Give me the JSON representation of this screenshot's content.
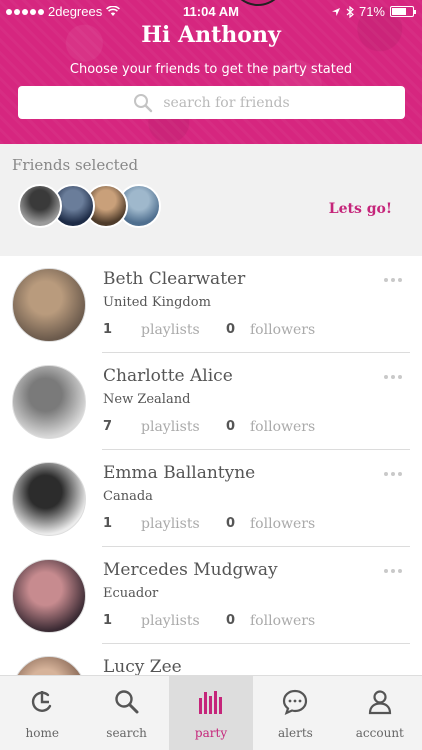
{
  "status_bar": {
    "carrier": "2degrees",
    "time": "11:04 AM",
    "battery": "71%",
    "battery_level": 0.71
  },
  "header": {
    "greeting": "Hi Anthony",
    "subtitle": "Choose your friends to get the party stated",
    "search": {
      "placeholder": "search for friends",
      "icon": "search-icon"
    }
  },
  "selected": {
    "label": "Friends selected",
    "action_label": "Lets go!",
    "avatars": [
      {
        "icon": "avatar-group-photo",
        "colors": [
          "#9a9a9a",
          "#3a3a3a"
        ]
      },
      {
        "icon": "avatar-group-photo",
        "colors": [
          "#1d2b46",
          "#6a7d9a"
        ]
      },
      {
        "icon": "avatar-group-photo",
        "colors": [
          "#4e3b2a",
          "#c9a07a"
        ]
      },
      {
        "icon": "avatar-group-photo",
        "colors": [
          "#4f6f8f",
          "#9fb8cc"
        ]
      }
    ]
  },
  "friends": [
    {
      "name": "Beth Clearwater",
      "country": "United Kingdom",
      "playlists": "1",
      "playlists_label": "playlists",
      "followers": "0",
      "followers_label": "followers",
      "colors": [
        "#6b5a4c",
        "#b99b7d"
      ]
    },
    {
      "name": "Charlotte Alice",
      "country": "New Zealand",
      "playlists": "7",
      "playlists_label": "playlists",
      "followers": "0",
      "followers_label": "followers",
      "colors": [
        "#d8d8d8",
        "#7a7a7a"
      ]
    },
    {
      "name": "Emma Ballantyne",
      "country": "Canada",
      "playlists": "1",
      "playlists_label": "playlists",
      "followers": "0",
      "followers_label": "followers",
      "colors": [
        "#ececec",
        "#2c2c2c"
      ]
    },
    {
      "name": "Mercedes Mudgway",
      "country": "Ecuador",
      "playlists": "1",
      "playlists_label": "playlists",
      "followers": "0",
      "followers_label": "followers",
      "colors": [
        "#3a2a33",
        "#c78b8f"
      ]
    },
    {
      "name": "Lucy Zee",
      "country": "",
      "playlists": "",
      "playlists_label": "",
      "followers": "",
      "followers_label": "",
      "colors": [
        "#7b5b4a",
        "#d6b39a"
      ]
    }
  ],
  "tabbar": {
    "items": [
      {
        "label": "home",
        "icon": "home-icon"
      },
      {
        "label": "search",
        "icon": "search-icon"
      },
      {
        "label": "party",
        "icon": "party-equalizer-icon",
        "active": true
      },
      {
        "label": "alerts",
        "icon": "chat-bubble-icon"
      },
      {
        "label": "account",
        "icon": "person-icon"
      }
    ]
  },
  "colors": {
    "brand": "#d6267f",
    "accent_text": "#c5257a",
    "tab_active_bg": "#dddddd"
  }
}
